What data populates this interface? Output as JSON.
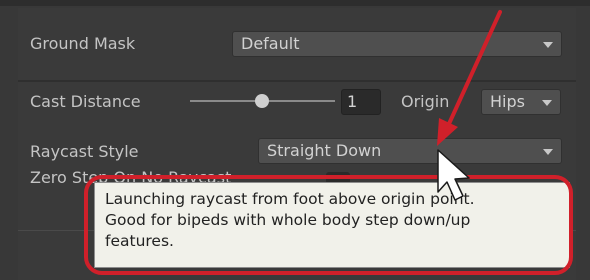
{
  "fields": {
    "ground_mask": {
      "label": "Ground Mask",
      "value": "Default"
    },
    "cast_distance": {
      "label": "Cast Distance",
      "value": "1",
      "slider_fraction": 0.45
    },
    "origin": {
      "label": "Origin",
      "value": "Hips"
    },
    "raycast_style": {
      "label": "Raycast Style",
      "value": "Straight Down"
    },
    "zero_step": {
      "label": "Zero Step On No Raycast"
    }
  },
  "tooltip": {
    "lines": [
      "Launching raycast from foot above origin point.",
      "Good for bipeds with whole body step down/up",
      "features."
    ]
  },
  "annotation": {
    "color": "#d0202a"
  },
  "icons": {
    "cursor": "mouse-pointer-icon",
    "arrow": "red-annotation-arrow"
  }
}
